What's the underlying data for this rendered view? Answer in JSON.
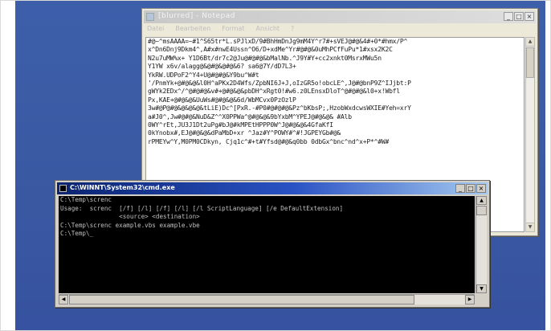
{
  "notepad": {
    "title": "[blurred] - Notepad",
    "menu": [
      "Datei",
      "Bearbeiten",
      "Format",
      "Ansicht",
      "?"
    ],
    "controls": {
      "minimize": "_",
      "maximize": "□",
      "close": "×"
    },
    "lines": [
      "#@~^msAAAA=~#1^S65tr*L.sPJlxD/9#BhHmDnJg9mM4Y^r7#+sVEJ@#@&4#+0*#hmx/P^",
      "x^Dn6Dnj9Dkm4^,A#x#nwE4Ussn^O6/D+xdMe^Yr#@#@&0uMhPCfFuPu*1#xsx2K2C",
      "N2u7uMW%x+        Y1D6Bt/dr7c2@Ju@#@#@&bMalNb.^J9Y#Y+cc2xnkt0MsrxMWu5n",
      "Y1YW      x6v/alagg@&@#@&@#@&6?       sa6@7Y/dD7L3+",
      "YkRW.UDPoF2^Y4+U@#@#@&Y9bu^W#t",
      "'/PnmYk+@#@&@&l0H^aPKx2D4Wfs/ZpbNI6J+J,oIzGR5o!obcLE^,J@#@bnP9Z^IJjbt:P",
      "gWYk2EDx^/^@#@#@&v#+@#@&@&pbDH^xRgt0!#w6.z0LEnsxDloT^@#@#@&l0+x!Wbfl",
      "Px,KAE+@#@&@&UuWs#@#@&@&6d/WbMCvx0PzOzlP",
      "3w#@P@#@&@&@&@&tLiE)Dc^[PxR.-#P0#@#@#@&Pz^bKbsP;,HzobWxdcwsWXIE#Yeh=xrY",
      "a#J0^,Jw#@#@&NuD&Z^^X0PPWa^@#@&@&9bYxbM^YPEJ@#@&@&           #Alb",
      "0WY^rEt,JU3J1Dt2uPg#bJ@#kMPEtHPPP0W^J@#@&@&4GfaKfI",
      "0kYnobx#,EJ@#@&@&dPaMbD+xr      ^Jaz#Y^POWY#^#!JGPEYGb#@&",
      "rPMEYw^Y,M0PM0CDkyn,           Cjq1c^#+t#Yfsd@#@&q0bb 0dbGx^bnc^nd^x+P*^#W#"
    ]
  },
  "console": {
    "title": "C:\\WINNT\\System32\\cmd.exe",
    "controls": {
      "minimize": "_",
      "maximize": "□",
      "close": "×"
    },
    "lines": [
      "C:\\Temp\\screnc",
      "",
      "Usage:  screnc  [/f] [/l] [/f] [/l] [/l ScriptLanguage] [/e DefaultExtension]",
      "                <source> <destination>",
      "",
      "",
      "C:\\Temp\\screnc example.vbs example.vbe",
      "",
      "C:\\Temp\\_"
    ]
  }
}
